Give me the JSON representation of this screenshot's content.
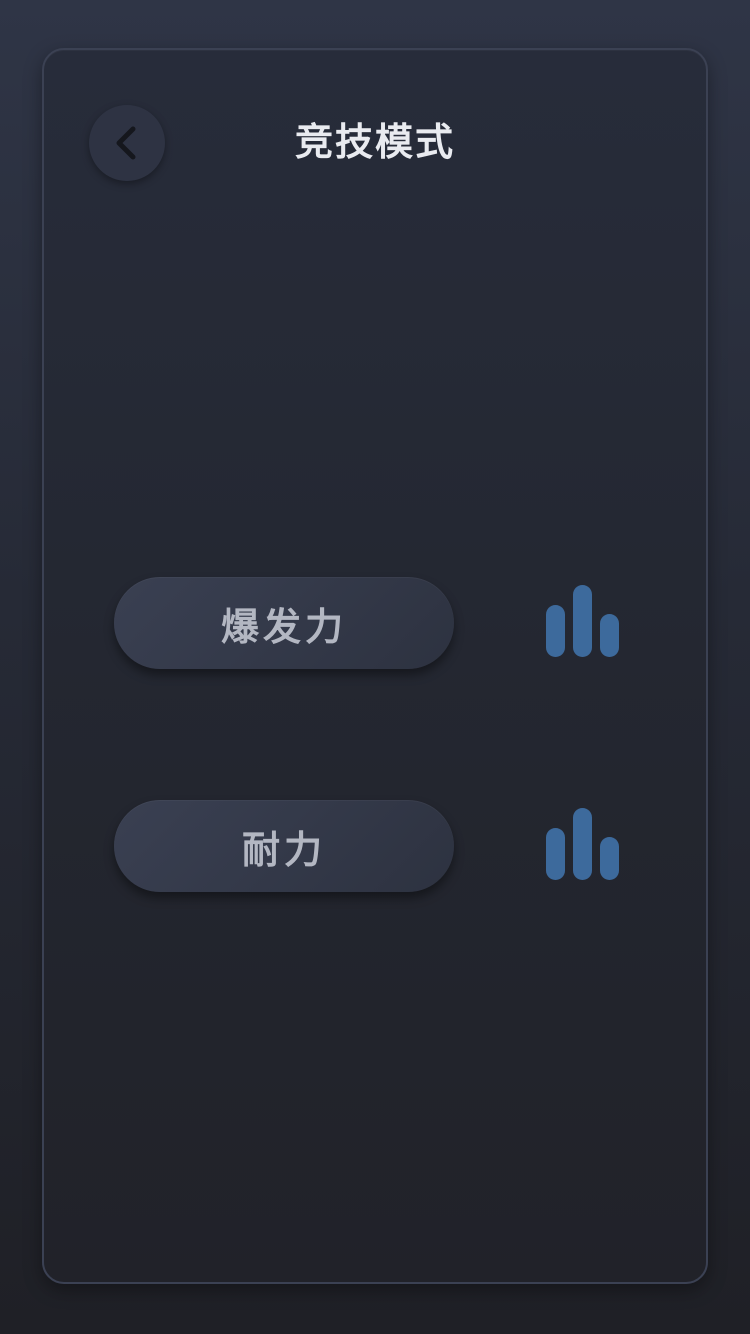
{
  "header": {
    "title": "竞技模式",
    "back_icon": "chevron-left-icon"
  },
  "modes": [
    {
      "label": "爆发力",
      "icon": "bar-level-icon"
    },
    {
      "label": "耐力",
      "icon": "bar-level-icon"
    }
  ],
  "colors": {
    "background": "#262a36",
    "panel": "#23262f",
    "pill": "#343949",
    "pill_text": "#b3b7c2",
    "title_text": "#e9ebf0",
    "icon_bars": "#3d6a9c"
  }
}
